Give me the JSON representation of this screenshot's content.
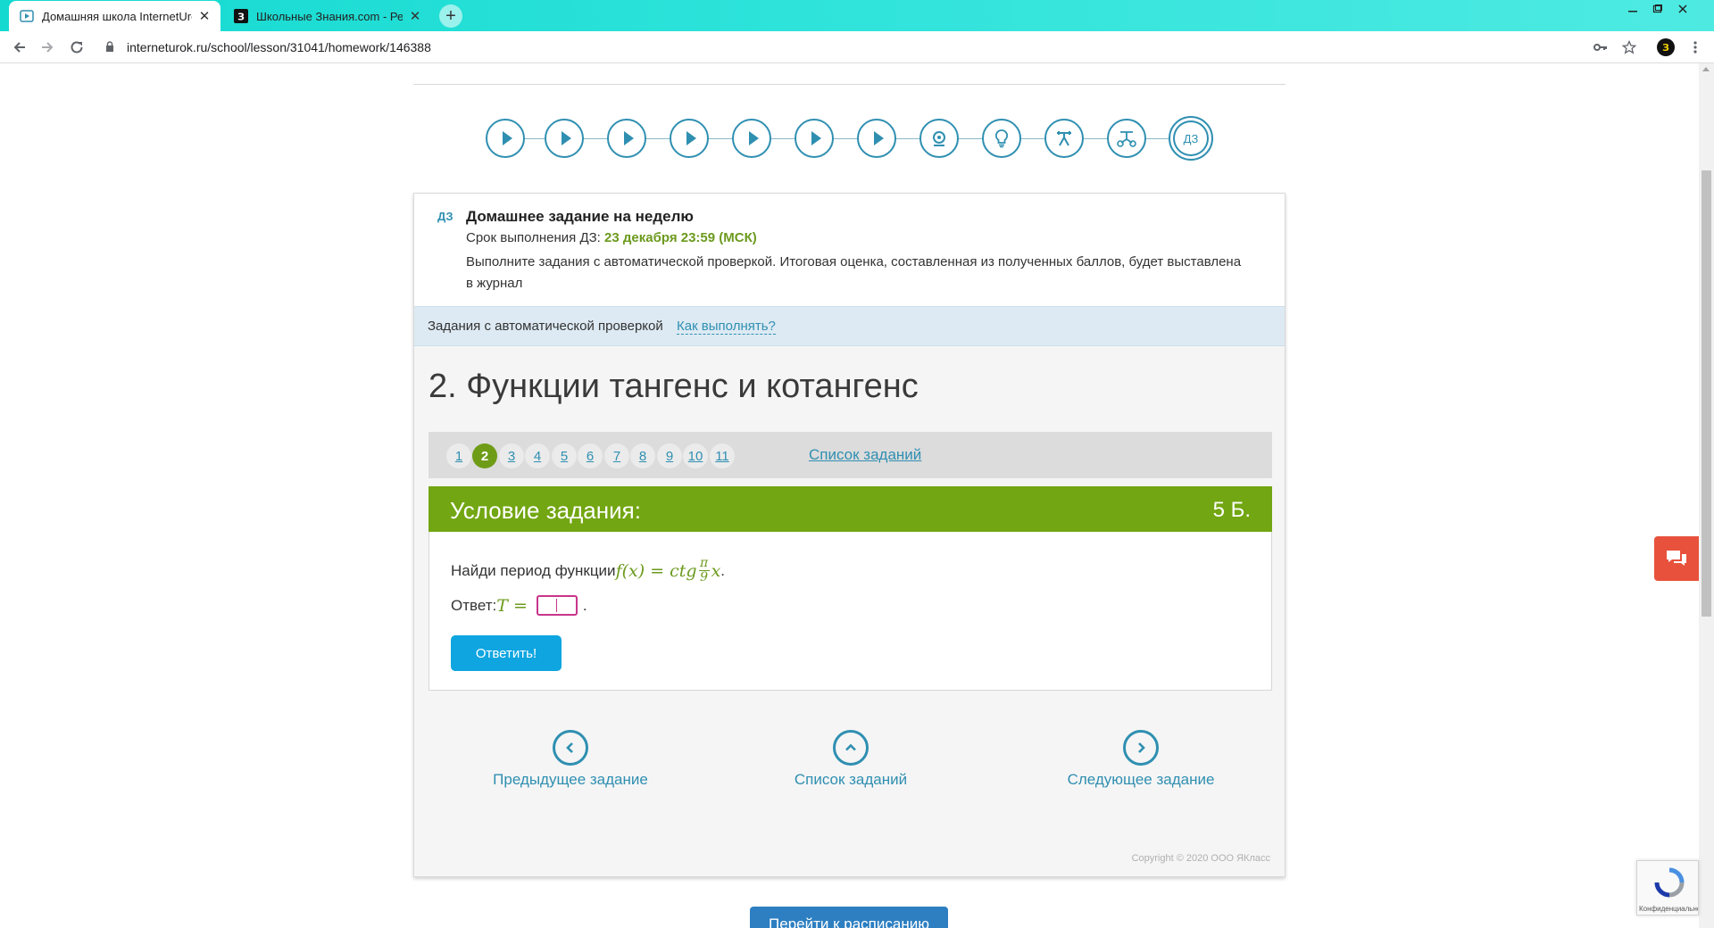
{
  "browser": {
    "tabs": [
      {
        "title": "Домашняя школа InternetUrok.ru",
        "close": "✕",
        "active": true
      },
      {
        "title": "Школьные Знания.com - Решае",
        "close": "✕",
        "active": false
      }
    ],
    "new_tab": "+",
    "window_controls": {
      "minimize": "—",
      "restore": "❐",
      "close": "✕"
    },
    "url": "interneturok.ru/school/lesson/31041/homework/146388",
    "profile_initial": "З"
  },
  "lesson_progress": {
    "steps": [
      "video-1",
      "video-2",
      "video-3",
      "video-4",
      "video-5",
      "video-6",
      "video-7",
      "webinar",
      "idea",
      "trainer",
      "tests",
      "homework"
    ],
    "current_label": "ДЗ"
  },
  "homework": {
    "badge": "ДЗ",
    "title": "Домашнее задание на неделю",
    "deadline_label": "Срок выполнения ДЗ: ",
    "deadline_value": "23 декабря 23:59 (МСК)",
    "description": "Выполните задания с автоматической проверкой. Итоговая оценка, составленная из полученных баллов, будет выставлена в журнал"
  },
  "auto_check": {
    "label": "Задания с автоматической проверкой",
    "how_link": "Как выполнять?"
  },
  "task": {
    "title": "2. Функции тангенс и котангенс",
    "numbers": [
      "1",
      "2",
      "3",
      "4",
      "5",
      "6",
      "7",
      "8",
      "9",
      "10",
      "11"
    ],
    "current_number": "2",
    "list_link": "Список заданий",
    "condition_header": "Условие задания:",
    "points": "5 Б.",
    "question_text": "Найди период функции ",
    "formula_left": "f(x) = ctg",
    "frac_num": "π",
    "frac_den": "9",
    "formula_right": "x",
    "question_end": ".",
    "answer_label": "Ответ: ",
    "answer_var": "T =",
    "answer_end": ".",
    "submit": "Ответить!"
  },
  "navigation": {
    "prev": "Предыдущее задание",
    "list": "Список заданий",
    "next": "Следующее задание"
  },
  "copyright": "Copyright © 2020 ООО ЯКласс",
  "schedule_button": "Перейти к расписанию",
  "recaptcha_text": "Конфиденциальность"
}
